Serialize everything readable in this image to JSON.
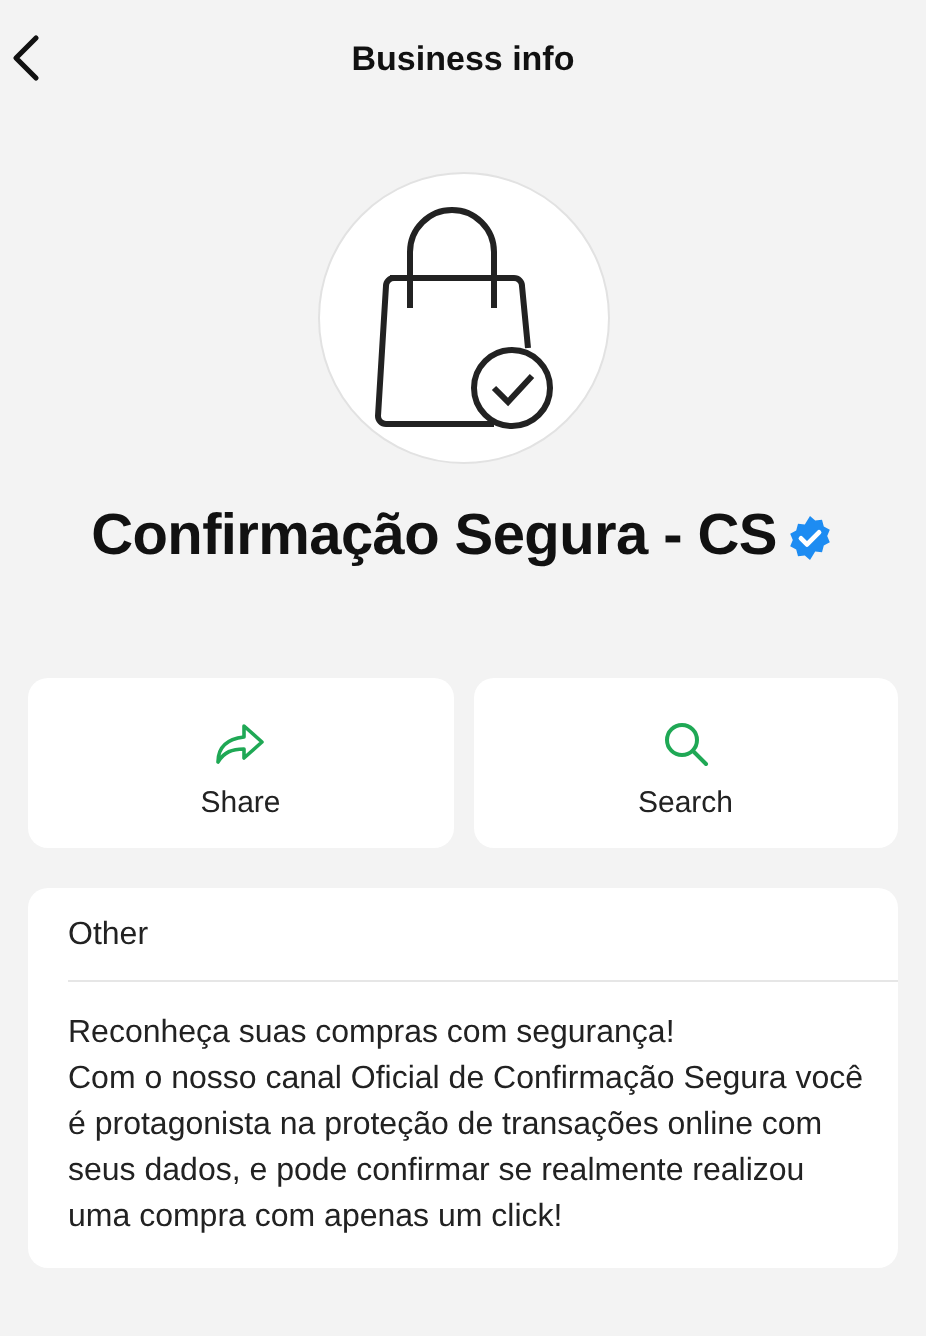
{
  "header": {
    "title": "Business info"
  },
  "profile": {
    "name": "Confirmação Segura - CS",
    "verified": true
  },
  "actions": [
    {
      "kind": "share",
      "label": "Share"
    },
    {
      "kind": "search",
      "label": "Search"
    }
  ],
  "about": {
    "heading": "Other",
    "text": "Reconheça suas compras com segurança!\nCom o nosso canal Oficial de Confirmação Segura você é protagonista na proteção de transações online com seus dados, e pode confirmar se realmente realizou uma compra com apenas um click!"
  }
}
